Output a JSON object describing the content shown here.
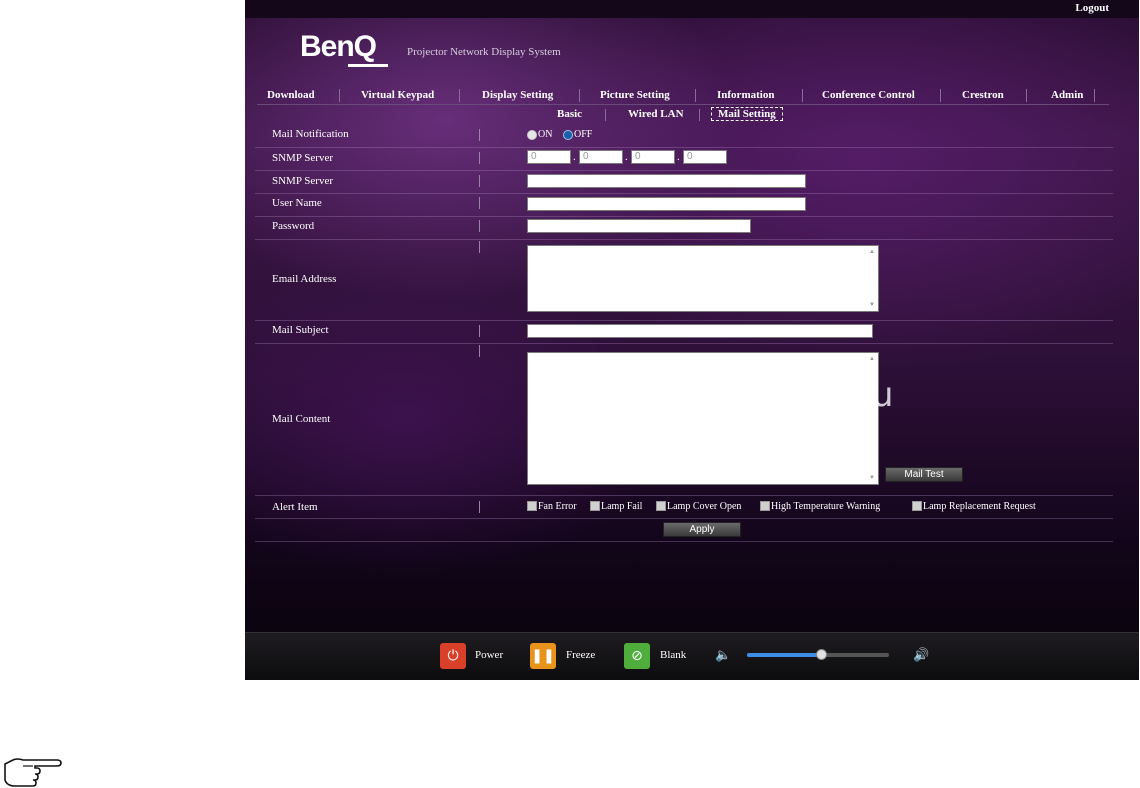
{
  "brand": {
    "logo": "BenQ",
    "app_title": "Projector Network Display System"
  },
  "header": {
    "logout": "Logout"
  },
  "nav": [
    "Download",
    "Virtual Keypad",
    "Display Setting",
    "Picture Setting",
    "Information",
    "Conference Control",
    "Crestron",
    "Admin"
  ],
  "subnav": {
    "items": [
      "Basic",
      "Wired LAN",
      "Mail Setting"
    ],
    "active": "Mail Setting"
  },
  "form": {
    "mail_notification": {
      "label": "Mail Notification",
      "on": "ON",
      "off": "OFF",
      "selected": "OFF"
    },
    "snmp_server_ip": {
      "label": "SNMP Server",
      "octets": [
        "0",
        "0",
        "0",
        "0"
      ]
    },
    "snmp_server": {
      "label": "SNMP Server",
      "value": ""
    },
    "user_name": {
      "label": "User Name",
      "value": ""
    },
    "password": {
      "label": "Password",
      "value": ""
    },
    "email_address": {
      "label": "Email Address",
      "value": ""
    },
    "mail_subject": {
      "label": "Mail Subject",
      "value": ""
    },
    "mail_content": {
      "label": "Mail Content",
      "value": ""
    },
    "mail_test_button": "Mail Test",
    "alert_item": {
      "label": "Alert Item",
      "options": [
        "Fan Error",
        "Lamp Fail",
        "Lamp Cover Open",
        "High Temperature Warning",
        "Lamp Replacement Request"
      ]
    },
    "apply_button": "Apply"
  },
  "controls": {
    "power": "Power",
    "freeze": "Freeze",
    "blank": "Blank",
    "volume_level": 0.52
  },
  "watermark": "McGrp.Ru",
  "colors": {
    "power": "#d9402a",
    "freeze": "#e8941c",
    "blank": "#4fae3b",
    "volume": "#3d8ee8"
  }
}
